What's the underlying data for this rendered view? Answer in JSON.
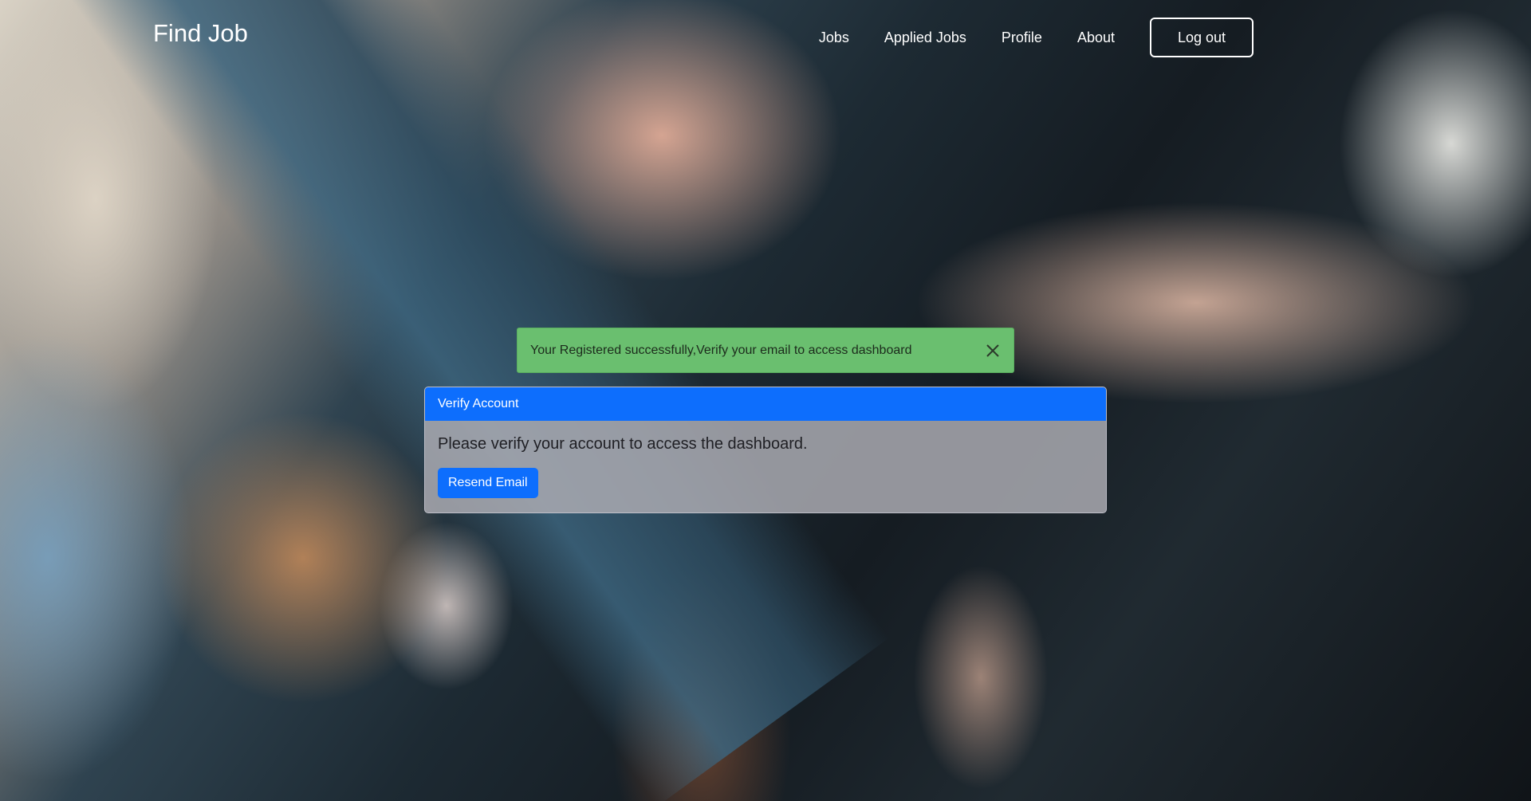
{
  "header": {
    "brand": "Find Job",
    "nav": {
      "jobs": "Jobs",
      "applied_jobs": "Applied Jobs",
      "profile": "Profile",
      "about": "About"
    },
    "logout_label": "Log out"
  },
  "alert": {
    "message": "Your Registered successfully,Verify your email to access dashboard",
    "close_icon": "close-icon",
    "color": "#6abf6f"
  },
  "card": {
    "title": "Verify Account",
    "text": "Please verify your account to access the dashboard.",
    "button_label": "Resend Email",
    "accent": "#0d6efd"
  }
}
